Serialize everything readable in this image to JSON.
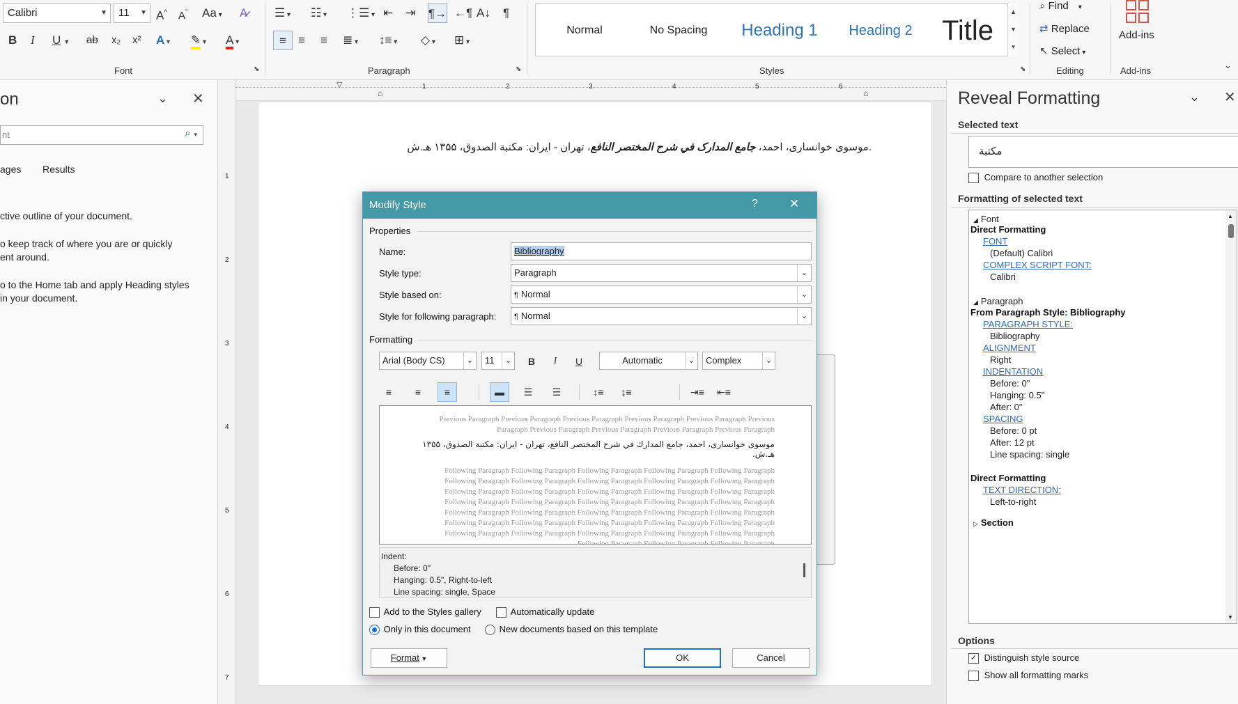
{
  "ribbon": {
    "font_name": "Calibri",
    "font_size": "11",
    "font_group_label": "Font",
    "paragraph_group_label": "Paragraph",
    "styles_group_label": "Styles",
    "editing_group_label": "Editing",
    "addins_group_label": "Add-ins",
    "styles": [
      "Normal",
      "No Spacing",
      "Heading 1",
      "Heading 2",
      "Title"
    ],
    "find_label": "Find",
    "replace_label": "Replace",
    "select_label": "Select",
    "addins_label": "Add-ins",
    "change_case_label": "Aa",
    "bold": "B",
    "italic": "I",
    "underline": "U",
    "strike": "ab",
    "subscript": "x₂",
    "superscript": "x²",
    "grow_font": "A^",
    "shrink_font": "Aˇ"
  },
  "navpane": {
    "title_fragment": "on",
    "search_placeholder": "nt",
    "tabs": [
      "ages",
      "Results"
    ],
    "text_lines": [
      "ctive outline of your document.",
      "o keep track of where you are or quickly",
      "ent around.",
      "o to the Home tab and apply Heading styles",
      "in your document."
    ]
  },
  "ruler": {
    "h_marks": [
      "1",
      "2",
      "3",
      "4",
      "5",
      "6"
    ],
    "v_marks": [
      "1",
      "2",
      "3",
      "4",
      "5",
      "6",
      "7"
    ]
  },
  "document": {
    "bibliography_line_prefix": ".موسوی خوانساری، احمد، ",
    "bibliography_line_italic": "جامع المدارک في شرح المختصر النافع",
    "bibliography_line_suffix": "، تهران - ایران: مكتبة الصدوق، ۱۳۵۵ هـ.ش"
  },
  "dialog": {
    "title": "Modify Style",
    "help": "?",
    "close": "✕",
    "properties_label": "Properties",
    "name_label": "Name:",
    "name_value": "Bibliography",
    "style_type_label": "Style type:",
    "style_type_value": "Paragraph",
    "based_on_label": "Style based on:",
    "based_on_value": "Normal",
    "following_label": "Style for following paragraph:",
    "following_value": "Normal",
    "formatting_label": "Formatting",
    "font_value": "Arial (Body CS)",
    "size_value": "11",
    "color_value": "Automatic",
    "script_value": "Complex",
    "bold": "B",
    "italic": "I",
    "underline": "U",
    "preview_prev_1": "Previous Paragraph Previous Paragraph Previous Paragraph Previous Paragraph Previous Paragraph Previous",
    "preview_prev_2": "Paragraph Previous Paragraph Previous Paragraph Previous Paragraph Previous Paragraph",
    "preview_sample": "موسوی خوانساری، احمد، جامع المدارك في شرح المختصر النافع، تهران - ایران: مكتبة الصدوق، ۱۳۵۵ هـ.ش.",
    "preview_following_line": "Following Paragraph Following Paragraph Following Paragraph Following Paragraph Following Paragraph",
    "preview_following_last": "Following Paragraph Following Paragraph Following Paragraph",
    "description": [
      "Indent:",
      "Before:  0\"",
      "Hanging:  0.5\", Right-to-left",
      "Line spacing:  single, Space"
    ],
    "add_gallery_label": "Add to the Styles gallery",
    "auto_update_label": "Automatically update",
    "only_doc_label": "Only in this document",
    "new_docs_label": "New documents based on this template",
    "format_button": "Format",
    "ok_button": "OK",
    "cancel_button": "Cancel"
  },
  "reveal": {
    "title": "Reveal Formatting",
    "selected_text_label": "Selected text",
    "selected_text_value": "مكتبة",
    "compare_label": "Compare to another selection",
    "formatting_label": "Formatting of selected text",
    "font_section": "Font",
    "font_direct": "Direct Formatting",
    "font_link": "FONT",
    "font_value": "(Default) Calibri",
    "complex_link": "COMPLEX SCRIPT FONT:",
    "complex_value": "Calibri",
    "paragraph_section": "Paragraph",
    "para_from": "From Paragraph Style: Bibliography",
    "para_style_link": "PARAGRAPH STYLE:",
    "para_style_value": "Bibliography",
    "alignment_link": "ALIGNMENT",
    "alignment_value": "Right",
    "indentation_link": "INDENTATION",
    "indent_before": "Before:  0\"",
    "indent_hanging": "Hanging:  0.5\"",
    "indent_after": "After:  0\"",
    "spacing_link": "SPACING",
    "spacing_before": "Before:  0 pt",
    "spacing_after": "After:  12 pt",
    "spacing_line": "Line spacing:  single",
    "direct_formatting": "Direct Formatting",
    "text_direction_link": "TEXT DIRECTION:",
    "text_direction_value": "Left-to-right",
    "section_label": "Section",
    "options_label": "Options",
    "distinguish_label": "Distinguish style source",
    "show_marks_label": "Show all formatting marks"
  },
  "colors": {
    "dialog_title_bg": "#4399a6",
    "link_blue": "#2f6ab3",
    "heading_blue": "#2e74b5",
    "addins_red": "#d9534f"
  }
}
